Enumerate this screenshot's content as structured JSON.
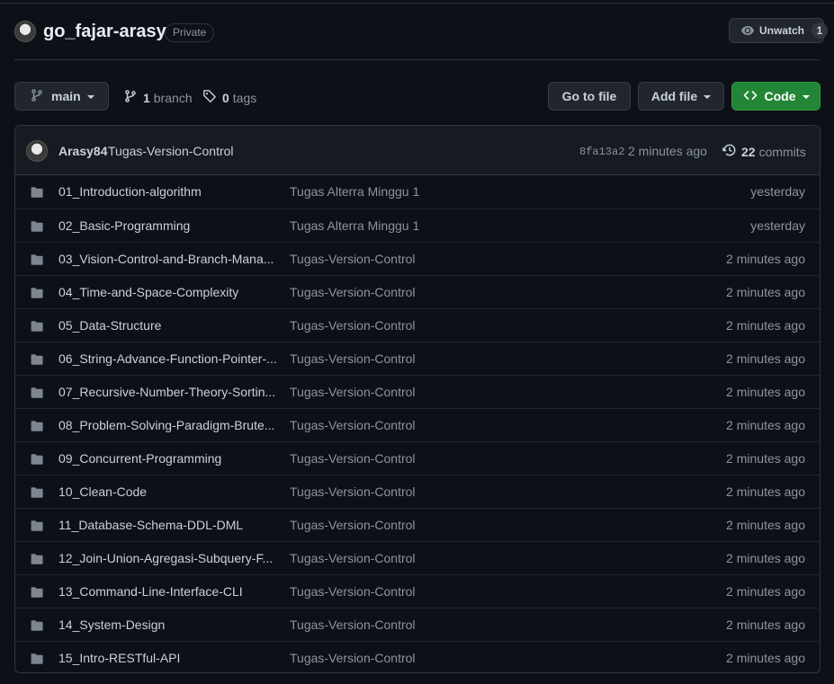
{
  "repo": {
    "name": "go_fajar-arasy",
    "visibility": "Private",
    "watch_label": "Unwatch",
    "watch_count": "1"
  },
  "toolbar": {
    "branch_label": "main",
    "branch_count": "1",
    "branch_word": "branch",
    "tag_count": "0",
    "tag_word": "tags",
    "goto_file_label": "Go to file",
    "add_file_label": "Add file",
    "code_label": "Code",
    "code_color": "#238636"
  },
  "commit": {
    "author": "Arasy84",
    "message": "Tugas-Version-Control",
    "sha": "8fa13a2",
    "time": "2 minutes ago",
    "commit_count": "22",
    "commit_word": "commits"
  },
  "files": [
    {
      "name": "01_Introduction-algorithm",
      "message": "Tugas Alterra Minggu 1",
      "time": "yesterday"
    },
    {
      "name": "02_Basic-Programming",
      "message": "Tugas Alterra Minggu 1",
      "time": "yesterday"
    },
    {
      "name": "03_Vision-Control-and-Branch-Mana...",
      "message": "Tugas-Version-Control",
      "time": "2 minutes ago"
    },
    {
      "name": "04_Time-and-Space-Complexity",
      "message": "Tugas-Version-Control",
      "time": "2 minutes ago"
    },
    {
      "name": "05_Data-Structure",
      "message": "Tugas-Version-Control",
      "time": "2 minutes ago"
    },
    {
      "name": "06_String-Advance-Function-Pointer-...",
      "message": "Tugas-Version-Control",
      "time": "2 minutes ago"
    },
    {
      "name": "07_Recursive-Number-Theory-Sortin...",
      "message": "Tugas-Version-Control",
      "time": "2 minutes ago"
    },
    {
      "name": "08_Problem-Solving-Paradigm-Brute...",
      "message": "Tugas-Version-Control",
      "time": "2 minutes ago"
    },
    {
      "name": "09_Concurrent-Programming",
      "message": "Tugas-Version-Control",
      "time": "2 minutes ago"
    },
    {
      "name": "10_Clean-Code",
      "message": "Tugas-Version-Control",
      "time": "2 minutes ago"
    },
    {
      "name": "11_Database-Schema-DDL-DML",
      "message": "Tugas-Version-Control",
      "time": "2 minutes ago"
    },
    {
      "name": "12_Join-Union-Agregasi-Subquery-F...",
      "message": "Tugas-Version-Control",
      "time": "2 minutes ago"
    },
    {
      "name": "13_Command-Line-Interface-CLI",
      "message": "Tugas-Version-Control",
      "time": "2 minutes ago"
    },
    {
      "name": "14_System-Design",
      "message": "Tugas-Version-Control",
      "time": "2 minutes ago"
    },
    {
      "name": "15_Intro-RESTful-API",
      "message": "Tugas-Version-Control",
      "time": "2 minutes ago"
    }
  ],
  "icons": {
    "folder": "folder-icon",
    "branch": "git-branch-icon",
    "tag": "tag-icon",
    "eye": "eye-icon",
    "history": "history-icon",
    "code": "code-icon"
  }
}
